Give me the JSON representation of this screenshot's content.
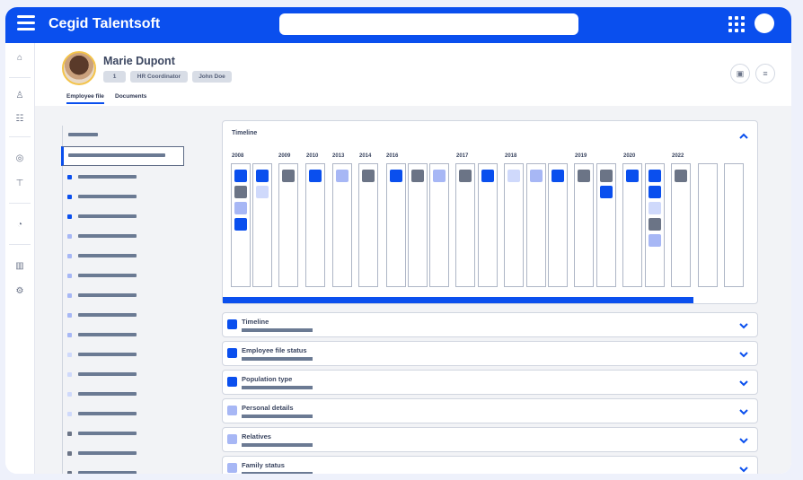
{
  "app": {
    "brand": "Cegid Talentsoft"
  },
  "colors": {
    "accent": "#0a4fee",
    "mid": "#a7b7f5",
    "light": "#cfd9fb",
    "gray": "#6b7486"
  },
  "employee": {
    "name": "Marie Dupont",
    "badges": [
      "1",
      "HR Coordinator",
      "John Doe"
    ]
  },
  "tabs": [
    {
      "label": "Employee file",
      "active": true
    },
    {
      "label": "Documents",
      "active": false
    }
  ],
  "timeline_card": {
    "title": "Timeline",
    "years": [
      "2008",
      "2009",
      "2010",
      "2013",
      "2014",
      "2016",
      "2017",
      "2018",
      "2019",
      "2020",
      "2022"
    ]
  },
  "sections": [
    {
      "title": "Timeline",
      "color": "accent"
    },
    {
      "title": "Employee file status",
      "color": "accent"
    },
    {
      "title": "Population type",
      "color": "accent"
    },
    {
      "title": "Personal details",
      "color": "mid"
    },
    {
      "title": "Relatives",
      "color": "mid"
    },
    {
      "title": "Family status",
      "color": "mid"
    }
  ]
}
